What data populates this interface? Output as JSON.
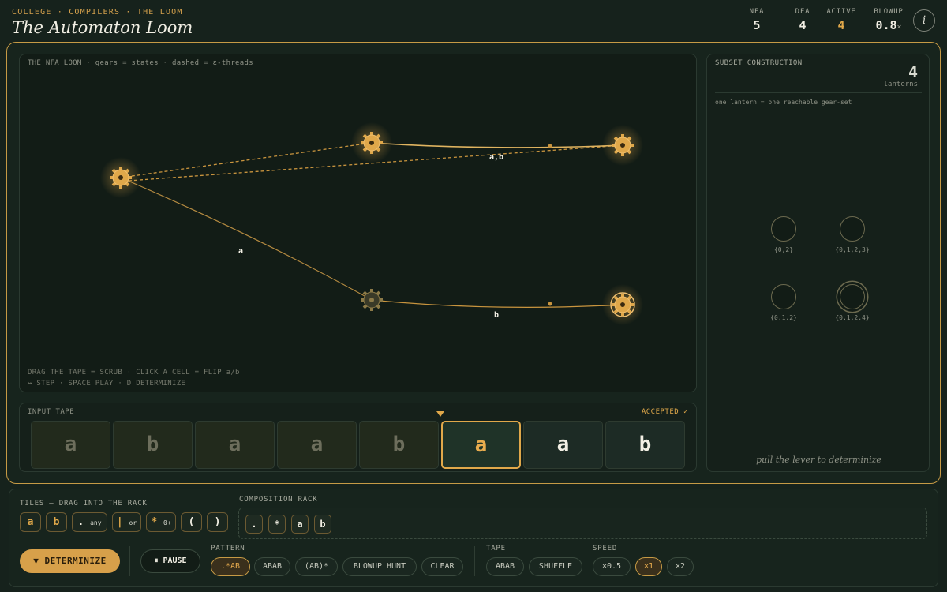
{
  "header": {
    "breadcrumb": "COLLEGE · COMPILERS · THE LOOM",
    "title": "The Automaton Loom",
    "stats": [
      {
        "label": "NFA",
        "value": "5"
      },
      {
        "label": "DFA",
        "value": "4"
      },
      {
        "label": "ACTIVE",
        "value": "4"
      },
      {
        "label": "BLOWUP",
        "value": "0.8",
        "unit": "×"
      }
    ],
    "info_glyph": "i"
  },
  "loom": {
    "caption": "THE NFA LOOM · gears = states · dashed = ε-threads",
    "help_line1": "DRAG THE TAPE = SCRUB · CLICK A CELL = FLIP a/b",
    "help_line2": "↔ STEP · SPACE PLAY · D DETERMINIZE",
    "edge_labels": [
      "a,b",
      "a",
      "b"
    ],
    "states": [
      {
        "id": 0,
        "start": true,
        "active": true,
        "accepting": false
      },
      {
        "id": 1,
        "active": true,
        "accepting": false
      },
      {
        "id": 2,
        "active": true,
        "accepting": false
      },
      {
        "id": 3,
        "active": false,
        "accepting": false
      },
      {
        "id": 4,
        "active": true,
        "accepting": true
      }
    ],
    "icon": "gear-icon"
  },
  "tape": {
    "label": "INPUT TAPE",
    "status": "ACCEPTED ✓",
    "head_index": 5,
    "cells": [
      "a",
      "b",
      "a",
      "a",
      "b",
      "a",
      "a",
      "b"
    ]
  },
  "subset": {
    "title": "SUBSET CONSTRUCTION",
    "count": "4",
    "count_unit": "lanterns",
    "note": "one lantern = one reachable gear-set",
    "lanterns": [
      {
        "set": "{0,2}",
        "accepting": false
      },
      {
        "set": "{0,1,2,3}",
        "accepting": false
      },
      {
        "set": "{0,1,2}",
        "accepting": false
      },
      {
        "set": "{0,1,2,4}",
        "accepting": true
      }
    ],
    "lever_text": "pull the lever to determinize"
  },
  "controls": {
    "tiles_label": "TILES — DRAG INTO THE RACK",
    "tiles": [
      {
        "glyph": "a",
        "sub": ""
      },
      {
        "glyph": "b",
        "sub": ""
      },
      {
        "glyph": ".",
        "sub": "any"
      },
      {
        "glyph": "|",
        "sub": "or"
      },
      {
        "glyph": "*",
        "sub": "0+"
      },
      {
        "glyph": "(",
        "sub": ""
      },
      {
        "glyph": ")",
        "sub": ""
      }
    ],
    "rack_label": "COMPOSITION RACK",
    "rack": [
      ".",
      "*",
      "a",
      "b"
    ],
    "determinize_label": "▼ DETERMINIZE",
    "pause_label": "⏸ PAUSE",
    "pattern_label": "PATTERN",
    "patterns": [
      ".*AB",
      "ABAB",
      "(AB)*",
      "BLOWUP HUNT",
      "CLEAR"
    ],
    "pattern_active": ".*AB",
    "tape_label": "TAPE",
    "tape_buttons": [
      "ABAB",
      "SHUFFLE"
    ],
    "speed_label": "SPEED",
    "speeds": [
      "×0.5",
      "×1",
      "×2"
    ],
    "speed_active": "×1",
    "colors": {
      "accent": "#e0a84a",
      "background": "#16221c",
      "panel": "#121c16"
    }
  }
}
